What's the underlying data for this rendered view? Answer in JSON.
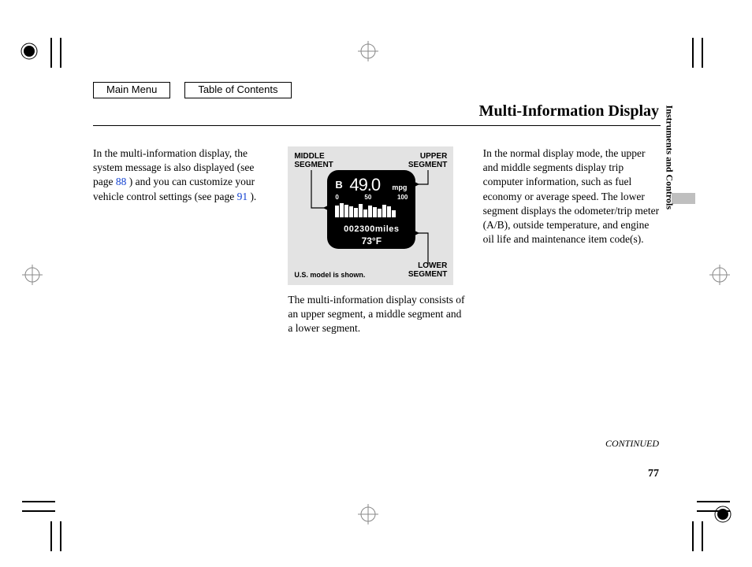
{
  "nav": {
    "main_menu": "Main Menu",
    "toc": "Table of Contents"
  },
  "title": "Multi-Information Display",
  "section_tab": "Instruments and Controls",
  "continued": "CONTINUED",
  "page_number": "77",
  "col1": {
    "pre_link1": "In the multi-information display, the system message is also displayed (see page ",
    "link1": "88",
    "mid": " ) and you can customize your vehicle control settings (see page ",
    "link2": "91",
    "post": " )."
  },
  "col2": {
    "labels": {
      "middle": "MIDDLE\nSEGMENT",
      "upper": "UPPER\nSEGMENT",
      "lower": "LOWER\nSEGMENT",
      "note": "U.S. model is shown."
    },
    "lcd": {
      "trip": "B",
      "value": "49.0",
      "unit": "mpg",
      "scale0": "0",
      "scale50": "50",
      "scale100": "100",
      "odo": "002300miles",
      "temp": "73°F"
    },
    "caption": "The multi-information display consists of an upper segment, a middle segment and a lower segment."
  },
  "col3": {
    "text": "In the normal display mode, the upper and middle segments display trip computer information, such as fuel economy or average speed. The lower segment displays the odometer/trip meter (A/B), outside temperature, and engine oil life and maintenance item code(s)."
  }
}
